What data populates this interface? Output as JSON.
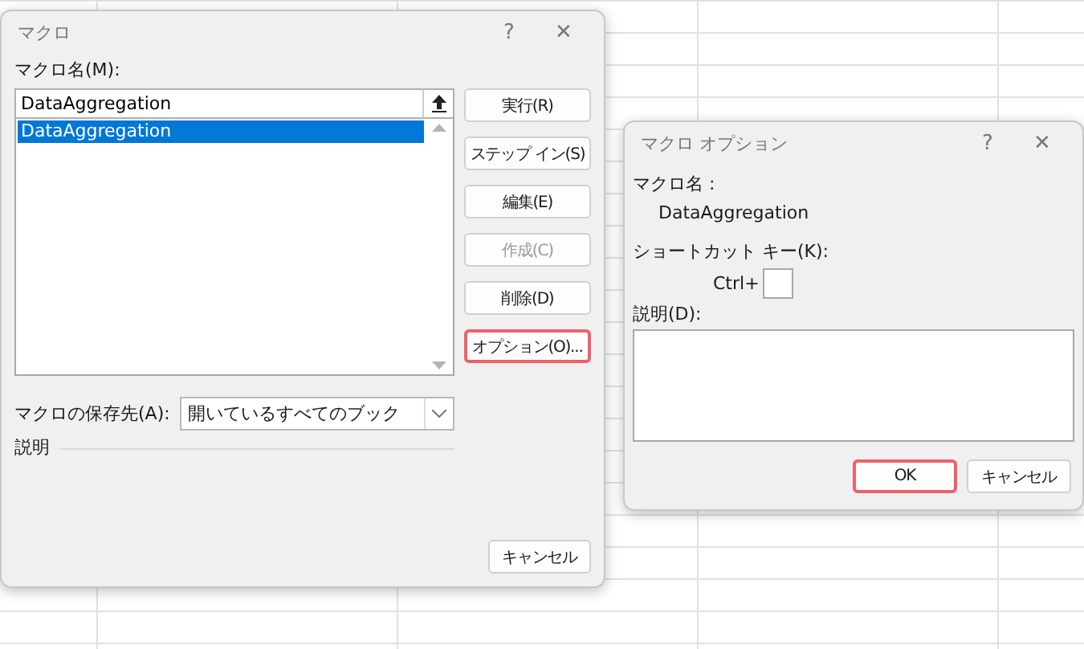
{
  "macro_dialog": {
    "title": "マクロ",
    "help": "?",
    "close": "✕",
    "name_label": "マクロ名(M):",
    "name_value": "DataAggregation",
    "macros": [
      {
        "label": "DataAggregation",
        "selected": true
      }
    ],
    "buttons": [
      {
        "label": "実行(R)",
        "disabled": false,
        "highlighted": false
      },
      {
        "label": "ステップ イン(S)",
        "disabled": false,
        "highlighted": false
      },
      {
        "label": "編集(E)",
        "disabled": false,
        "highlighted": false
      },
      {
        "label": "作成(C)",
        "disabled": true,
        "highlighted": false
      },
      {
        "label": "削除(D)",
        "disabled": false,
        "highlighted": false
      },
      {
        "label": "オプション(O)...",
        "disabled": false,
        "highlighted": true
      }
    ],
    "store_label": "マクロの保存先(A):",
    "store_value": "開いているすべてのブック",
    "description_label": "説明",
    "cancel": "キャンセル"
  },
  "options_dialog": {
    "title": "マクロ オプション",
    "help": "?",
    "close": "✕",
    "name_label": "マクロ名 :",
    "name_value": "DataAggregation",
    "shortcut_label": "ショートカット キー(K):",
    "ctrl_label": "Ctrl+",
    "description_label": "説明(D):",
    "buttons": [
      {
        "label": "OK",
        "highlighted": true
      },
      {
        "label": "キャンセル",
        "highlighted": false
      }
    ]
  }
}
